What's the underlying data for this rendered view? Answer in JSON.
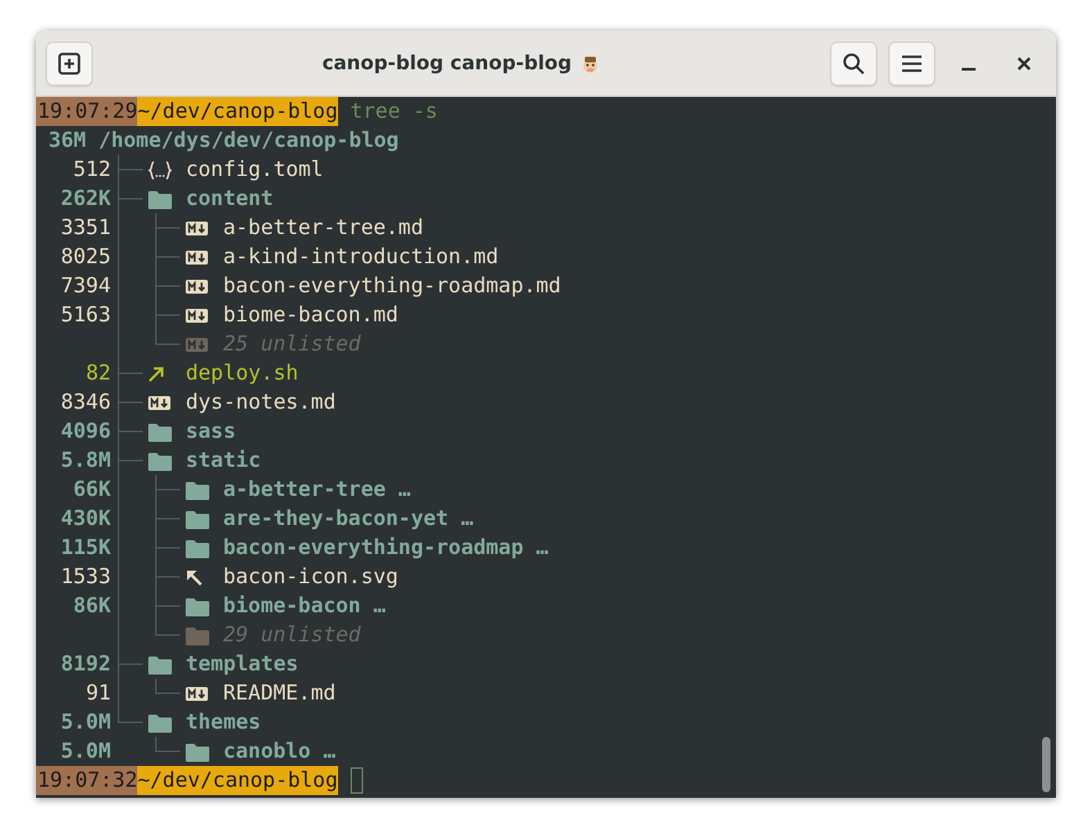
{
  "window": {
    "title": "canop-blog canop-blog"
  },
  "prompts": [
    {
      "time": "19:07:29",
      "path": "~/dev/canop-blog",
      "command": "tree -s",
      "cursor": false
    },
    {
      "time": "19:07:32",
      "path": "~/dev/canop-blog",
      "cursor": true
    }
  ],
  "tree": {
    "size": "36M",
    "path": "/home/dys/dev/canop-blog",
    "children": [
      {
        "kind": "config",
        "size": "512",
        "name": "config.toml"
      },
      {
        "kind": "dir",
        "size": "262K",
        "name": "content",
        "children": [
          {
            "kind": "markdown",
            "size": "3351",
            "name": "a-better-tree.md"
          },
          {
            "kind": "markdown",
            "size": "8025",
            "name": "a-kind-introduction.md"
          },
          {
            "kind": "markdown",
            "size": "7394",
            "name": "bacon-everything-roadmap.md"
          },
          {
            "kind": "markdown",
            "size": "5163",
            "name": "biome-bacon.md"
          },
          {
            "kind": "unlisted-files",
            "name": "25 unlisted"
          }
        ]
      },
      {
        "kind": "script",
        "size": "82",
        "name": "deploy.sh"
      },
      {
        "kind": "markdown",
        "size": "8346",
        "name": "dys-notes.md"
      },
      {
        "kind": "dir",
        "size": "4096",
        "name": "sass"
      },
      {
        "kind": "dir",
        "size": "5.8M",
        "name": "static",
        "children": [
          {
            "kind": "dir",
            "size": "66K",
            "name": "a-better-tree …"
          },
          {
            "kind": "dir",
            "size": "430K",
            "name": "are-they-bacon-yet …"
          },
          {
            "kind": "dir",
            "size": "115K",
            "name": "bacon-everything-roadmap …"
          },
          {
            "kind": "image",
            "size": "1533",
            "name": "bacon-icon.svg"
          },
          {
            "kind": "dir",
            "size": "86K",
            "name": "biome-bacon …"
          },
          {
            "kind": "unlisted-dirs",
            "name": "29 unlisted"
          }
        ]
      },
      {
        "kind": "dir",
        "size": "8192",
        "name": "templates",
        "children": [
          {
            "kind": "markdown",
            "size": "91",
            "name": "README.md"
          }
        ]
      },
      {
        "kind": "dir",
        "size": "5.0M",
        "name": "themes",
        "children": [
          {
            "kind": "dir",
            "size": "5.0M",
            "name": "canoblo …"
          }
        ]
      }
    ]
  }
}
